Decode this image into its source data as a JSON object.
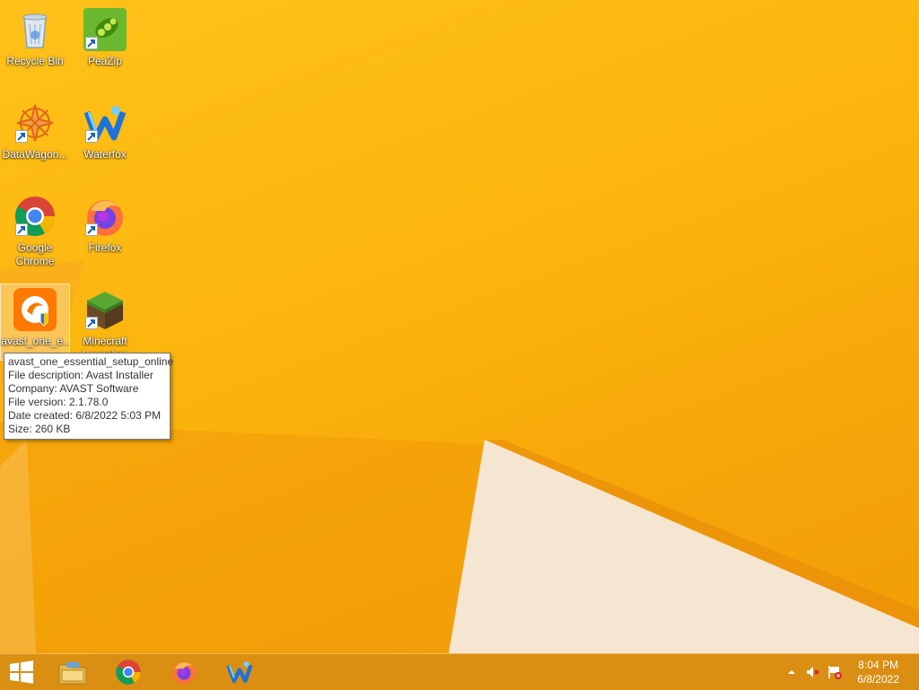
{
  "desktop": {
    "icons": [
      {
        "label": "Recycle Bin"
      },
      {
        "label": "PeaZip"
      },
      {
        "label": "DataWagon..."
      },
      {
        "label": "Waterfox"
      },
      {
        "label": "Google Chrome"
      },
      {
        "label": "Firefox"
      },
      {
        "label": "avast_one_e..."
      },
      {
        "label": "Minecraft Launcher"
      }
    ]
  },
  "tooltip": {
    "lines": [
      "avast_one_essential_setup_online",
      "File description: Avast Installer",
      "Company: AVAST Software",
      "File version: 2.1.78.0",
      "Date created: 6/8/2022 5:03 PM",
      "Size: 260 KB"
    ]
  },
  "taskbar": {
    "pinned": [
      "start-button",
      "file-explorer",
      "google-chrome",
      "firefox",
      "waterfox"
    ],
    "clock": {
      "time": "8:04 PM",
      "date": "6/8/2022"
    }
  }
}
